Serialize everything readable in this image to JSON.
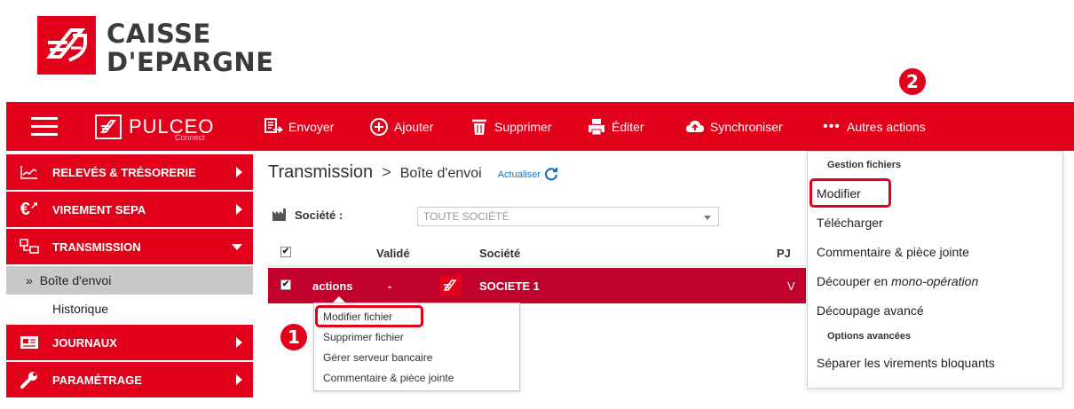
{
  "brand": {
    "line1": "CAISSE",
    "line2": "D'EPARGNE",
    "app_name": "PULCEO",
    "app_sub": "Connect"
  },
  "badges": {
    "one": "1",
    "two": "2"
  },
  "toolbar": {
    "actions": [
      {
        "label": "Envoyer",
        "icon": "send-icon"
      },
      {
        "label": "Ajouter",
        "icon": "plus-circle-icon"
      },
      {
        "label": "Supprimer",
        "icon": "trash-icon"
      },
      {
        "label": "Éditer",
        "icon": "printer-icon"
      },
      {
        "label": "Synchroniser",
        "icon": "cloud-sync-icon"
      },
      {
        "label": "Autres actions",
        "icon": "more-dots-icon"
      }
    ]
  },
  "sidebar": {
    "items": [
      {
        "label": "RELEVÉS & TRÉSORERIE",
        "icon": "chart-line-icon"
      },
      {
        "label": "VIREMENT SEPA",
        "icon": "euro-transfer-icon"
      },
      {
        "label": "TRANSMISSION",
        "icon": "transmission-icon"
      },
      {
        "label": "JOURNAUX",
        "icon": "journal-icon"
      },
      {
        "label": "PARAMÉTRAGE",
        "icon": "wrench-icon"
      }
    ],
    "subitems": [
      {
        "label": "Boîte d'envoi",
        "prefix": "»"
      },
      {
        "label": "Historique"
      }
    ]
  },
  "breadcrumb": {
    "main": "Transmission",
    "separator": ">",
    "sub": "Boîte d'envoi",
    "refresh": "Actualiser"
  },
  "filter": {
    "label": "Société :",
    "value": "TOUTE SOCIÉTÉ"
  },
  "table": {
    "headers": {
      "check": "✔",
      "valide": "Validé",
      "societe": "Société",
      "pj": "PJ"
    },
    "rows": [
      {
        "check": "✔",
        "actions": "actions",
        "valide": "-",
        "societe": "SOCIETE 1",
        "pj": "V"
      }
    ]
  },
  "context_menu": {
    "items": [
      "Modifier fichier",
      "Supprimer fichier",
      "Gérer serveur bancaire",
      "Commentaire & pièce jointe"
    ]
  },
  "dropdown": {
    "section1": "Gestion fichiers",
    "items1": [
      "Modifier",
      "Télécharger",
      "Commentaire & pièce jointe",
      "Découper en",
      "Découpage avancé"
    ],
    "italic_part": "mono-opération",
    "section2": "Options avancées",
    "items2": [
      "Séparer les virements bloquants"
    ]
  },
  "colors": {
    "brand_red": "#e2001a",
    "row_red": "#c1002c",
    "active_grey": "#c8c8c8"
  }
}
